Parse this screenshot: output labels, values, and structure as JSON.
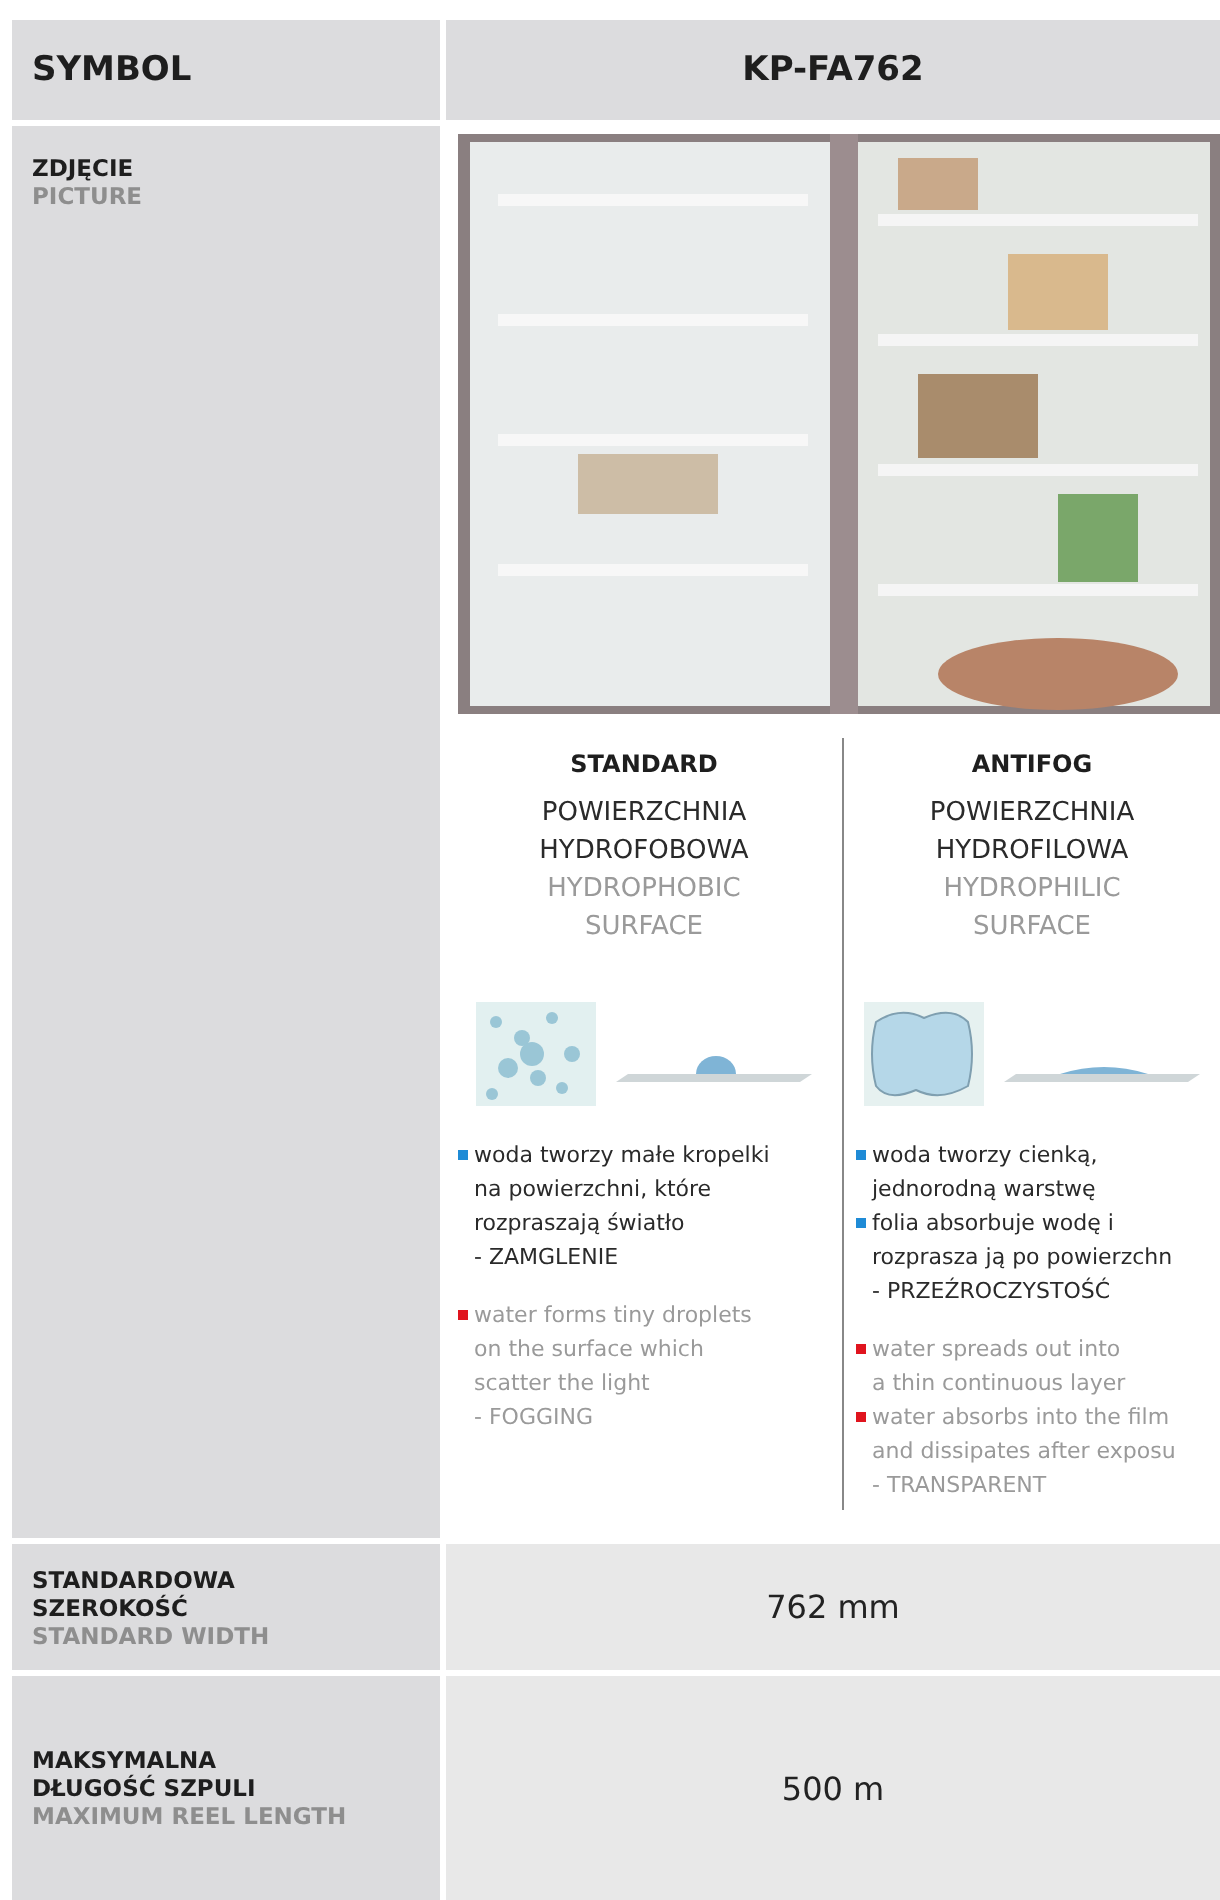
{
  "header": {
    "label": "SYMBOL",
    "value": "KP-FA762"
  },
  "picture_row": {
    "label_pl": "ZDJĘCIE",
    "label_en": "PICTURE",
    "comparison": [
      {
        "heading": "STANDARD",
        "surface_pl": [
          "POWIERZCHNIA",
          "HYDROFOBOWA"
        ],
        "surface_en": [
          "HYDROPHOBIC",
          "SURFACE"
        ],
        "illustration": {
          "kind": "droplets"
        },
        "points": [
          {
            "kind": "pl",
            "text": "woda tworzy małe kropelki\nna powierzchni, które\nrozpraszają światło\n- ZAMGLENIE"
          },
          {
            "kind": "en",
            "text": "water forms tiny droplets\non the surface which\nscatter the light\n- FOGGING"
          }
        ]
      },
      {
        "heading": "ANTIFOG",
        "surface_pl": [
          "POWIERZCHNIA",
          "HYDROFILOWA"
        ],
        "surface_en": [
          "HYDROPHILIC",
          "SURFACE"
        ],
        "illustration": {
          "kind": "film"
        },
        "points": [
          {
            "kind": "pl",
            "text": "woda tworzy cienką,\njednorodną warstwę"
          },
          {
            "kind": "pl",
            "text": "folia absorbuje wodę i\nrozprasza ją po powierzchn\n- PRZEŹROCZYSTOŚĆ"
          },
          {
            "kind": "en",
            "text": "water spreads out into\na thin continuous layer"
          },
          {
            "kind": "en",
            "text": "water absorbs into the film\nand dissipates after exposu\n- TRANSPARENT"
          }
        ]
      }
    ]
  },
  "spec_rows": [
    {
      "label_pl": "STANDARDOWA\nSZEROKOŚĆ",
      "label_en": "STANDARD WIDTH",
      "value": "762 mm"
    },
    {
      "label_pl": "MAKSYMALNA\nDŁUGOŚĆ SZPULI",
      "label_en": "MAXIMUM REEL LENGTH",
      "value": "500 m"
    }
  ]
}
